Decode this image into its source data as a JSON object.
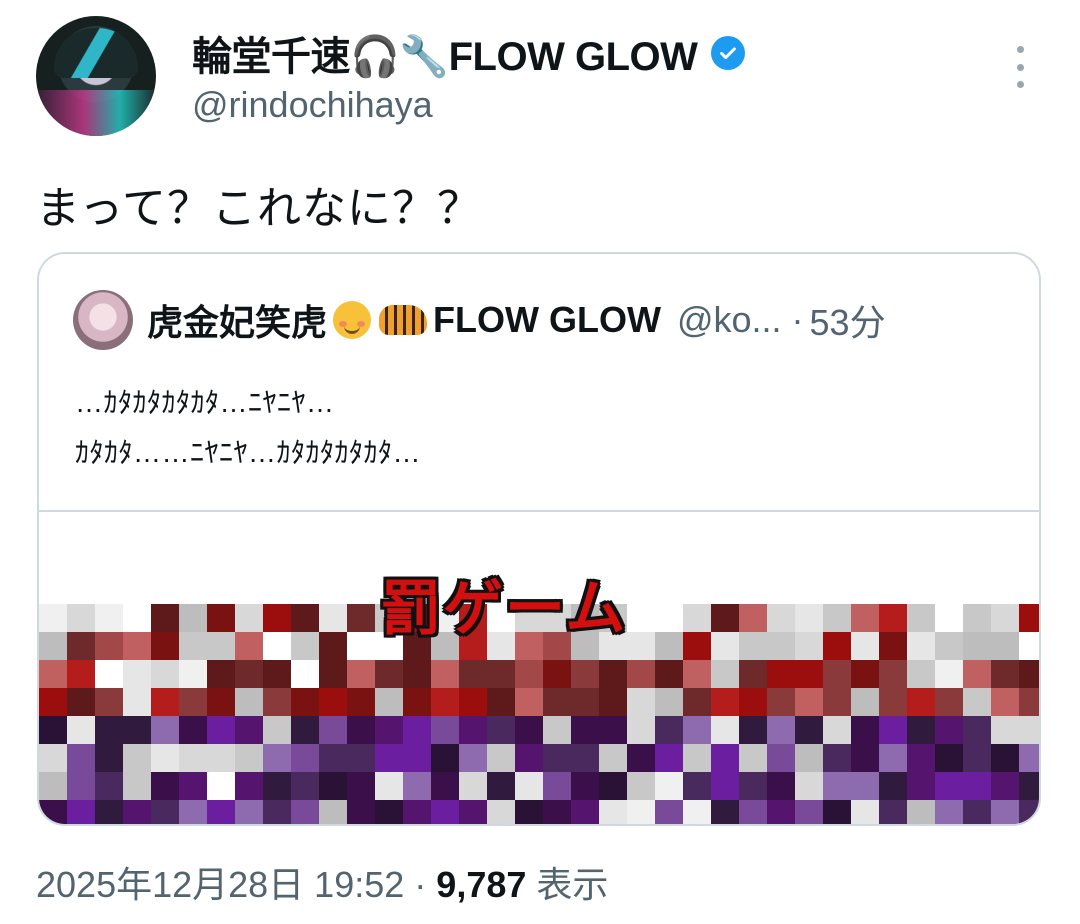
{
  "author": {
    "display_name": "輪堂千速🎧🔧FLOW GLOW",
    "handle": "@rindochihaya",
    "verified": true,
    "badge_color": "#1d9bf0"
  },
  "tweet": {
    "text": "まって？これなに？？",
    "timestamp": "2025年12月28日 19:52",
    "separator": "·",
    "views_count": "9,787",
    "views_label": "表示"
  },
  "quoted_tweet": {
    "display_name_prefix": "虎金妃笑虎",
    "emoji_1": "smiling-face-emoji",
    "emoji_2": "tiger-emoji",
    "display_name_suffix": "FLOW GLOW",
    "handle": "@ko...",
    "separator": "·",
    "time": "53分",
    "text_line_1": "…ｶﾀｶﾀｶﾀｶﾀ…ﾆﾔﾆﾔ…",
    "text_line_2": "ｶﾀｶﾀ……ﾆﾔﾆﾔ…ｶﾀｶﾀｶﾀｶﾀ…",
    "media_title": "罰ゲーム"
  },
  "icons": {
    "more": "more-vertical-icon",
    "verified": "verified-badge-icon"
  }
}
